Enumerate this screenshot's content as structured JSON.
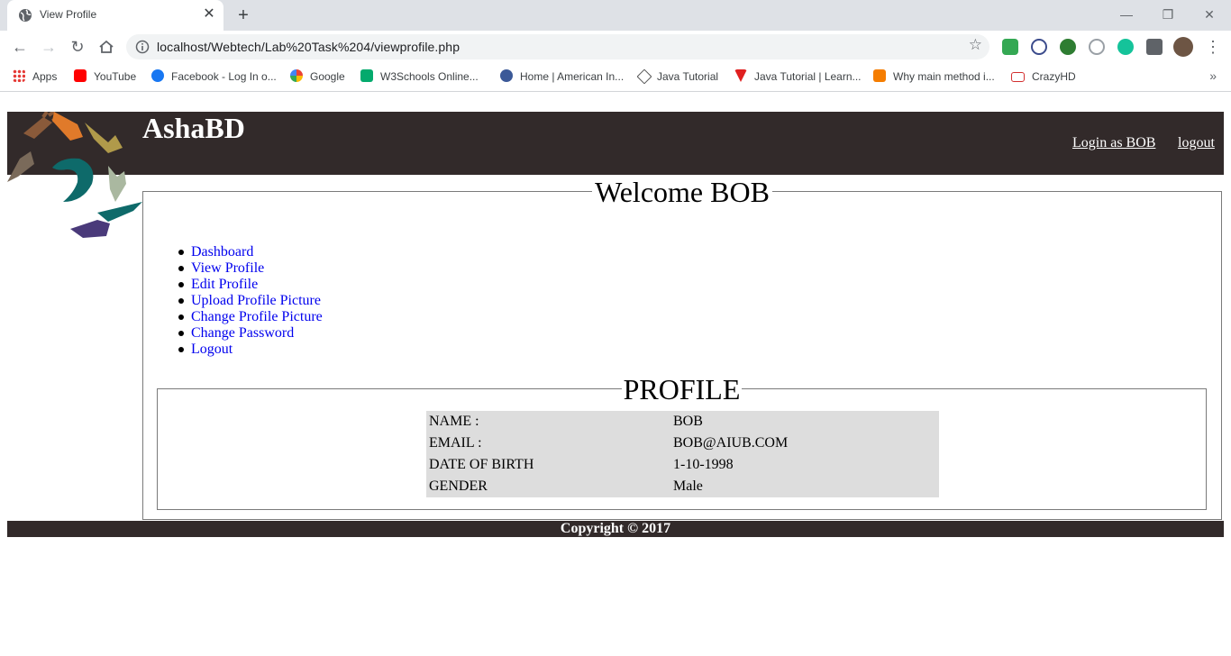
{
  "browser": {
    "tab_title": "View Profile",
    "tab_close_icon": "close-icon",
    "new_tab_icon": "plus-icon",
    "url": "localhost/Webtech/Lab%20Task%204/viewprofile.php",
    "bookmarks": [
      {
        "label": "Apps",
        "icon": "apps-grid-icon",
        "color": "#e53935"
      },
      {
        "label": "YouTube",
        "icon": "youtube-icon",
        "color": "#ff0000"
      },
      {
        "label": "Facebook - Log In o...",
        "icon": "facebook-icon",
        "color": "#1877f2"
      },
      {
        "label": "Google",
        "icon": "google-icon",
        "color": "#4285f4"
      },
      {
        "label": "W3Schools Online...",
        "icon": "w3schools-icon",
        "color": "#04aa6d"
      },
      {
        "label": "Home | American In...",
        "icon": "aiub-icon",
        "color": "#3b5998"
      },
      {
        "label": "Java Tutorial",
        "icon": "java-tutorial-icon",
        "color": "#555555"
      },
      {
        "label": "Java Tutorial | Learn...",
        "icon": "javatpoint-icon",
        "color": "#e02020"
      },
      {
        "label": "Why main method i...",
        "icon": "blogger-icon",
        "color": "#f57d00"
      },
      {
        "label": "CrazyHD",
        "icon": "crazyhd-icon",
        "color": "#d32f2f"
      }
    ]
  },
  "site": {
    "title": "AshaBD",
    "login_label": "Login as BOB",
    "logout_label": "logout",
    "welcome": "Welcome BOB",
    "menu": [
      "Dashboard",
      "View Profile",
      "Edit Profile",
      "Upload Profile Picture",
      "Change Profile Picture",
      "Change Password",
      "Logout"
    ],
    "profile_title": "PROFILE",
    "profile_rows": [
      {
        "label": "NAME :",
        "value": "BOB"
      },
      {
        "label": "EMAIL :",
        "value": "BOB@AIUB.COM"
      },
      {
        "label": "DATE OF BIRTH",
        "value": "1-10-1998"
      },
      {
        "label": "GENDER",
        "value": "Male"
      }
    ],
    "footer": "Copyright © 2017"
  },
  "colors": {
    "header_bg": "#322a2a",
    "link": "#0000ee",
    "table_bg": "#dddddd"
  }
}
